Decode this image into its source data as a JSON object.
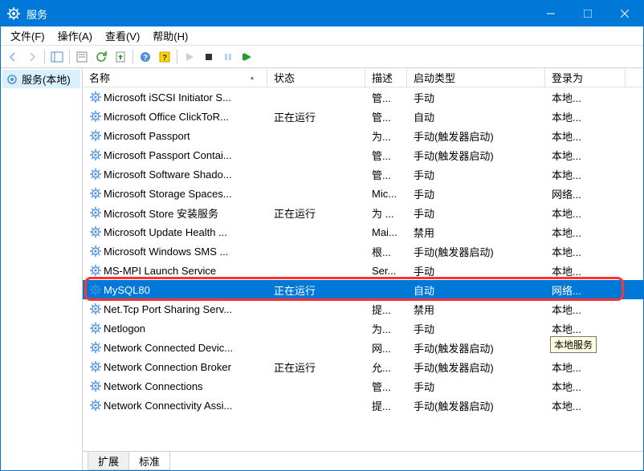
{
  "window": {
    "title": "服务"
  },
  "menubar": {
    "file": "文件(F)",
    "action": "操作(A)",
    "view": "查看(V)",
    "help": "帮助(H)"
  },
  "tree": {
    "root": "服务(本地)"
  },
  "columns": {
    "name": "名称",
    "status": "状态",
    "description": "描述",
    "startup": "启动类型",
    "logon": "登录为"
  },
  "services": [
    {
      "name": "Microsoft iSCSI Initiator S...",
      "status": "",
      "desc": "管...",
      "startup": "手动",
      "logon": "本地..."
    },
    {
      "name": "Microsoft Office ClickToR...",
      "status": "正在运行",
      "desc": "管...",
      "startup": "自动",
      "logon": "本地..."
    },
    {
      "name": "Microsoft Passport",
      "status": "",
      "desc": "为...",
      "startup": "手动(触发器启动)",
      "logon": "本地..."
    },
    {
      "name": "Microsoft Passport Contai...",
      "status": "",
      "desc": "管...",
      "startup": "手动(触发器启动)",
      "logon": "本地..."
    },
    {
      "name": "Microsoft Software Shado...",
      "status": "",
      "desc": "管...",
      "startup": "手动",
      "logon": "本地..."
    },
    {
      "name": "Microsoft Storage Spaces...",
      "status": "",
      "desc": "Mic...",
      "startup": "手动",
      "logon": "网络..."
    },
    {
      "name": "Microsoft Store 安装服务",
      "status": "正在运行",
      "desc": "为 ...",
      "startup": "手动",
      "logon": "本地..."
    },
    {
      "name": "Microsoft Update Health ...",
      "status": "",
      "desc": "Mai...",
      "startup": "禁用",
      "logon": "本地..."
    },
    {
      "name": "Microsoft Windows SMS ...",
      "status": "",
      "desc": "根...",
      "startup": "手动(触发器启动)",
      "logon": "本地..."
    },
    {
      "name": "MS-MPI Launch Service",
      "status": "",
      "desc": "Ser...",
      "startup": "手动",
      "logon": "本地..."
    },
    {
      "name": "MySQL80",
      "status": "正在运行",
      "desc": "",
      "startup": "自动",
      "logon": "网络...",
      "selected": true
    },
    {
      "name": "Net.Tcp Port Sharing Serv...",
      "status": "",
      "desc": "提...",
      "startup": "禁用",
      "logon": "本地..."
    },
    {
      "name": "Netlogon",
      "status": "",
      "desc": "为...",
      "startup": "手动",
      "logon": "本地..."
    },
    {
      "name": "Network Connected Devic...",
      "status": "",
      "desc": "网...",
      "startup": "手动(触发器启动)",
      "logon": "本地服务",
      "tooltip": true
    },
    {
      "name": "Network Connection Broker",
      "status": "正在运行",
      "desc": "允...",
      "startup": "手动(触发器启动)",
      "logon": "本地..."
    },
    {
      "name": "Network Connections",
      "status": "",
      "desc": "管...",
      "startup": "手动",
      "logon": "本地..."
    },
    {
      "name": "Network Connectivity Assi...",
      "status": "",
      "desc": "提...",
      "startup": "手动(触发器启动)",
      "logon": "本地..."
    }
  ],
  "tabs": {
    "extended": "扩展",
    "standard": "标准"
  },
  "tooltip": "本地服务"
}
